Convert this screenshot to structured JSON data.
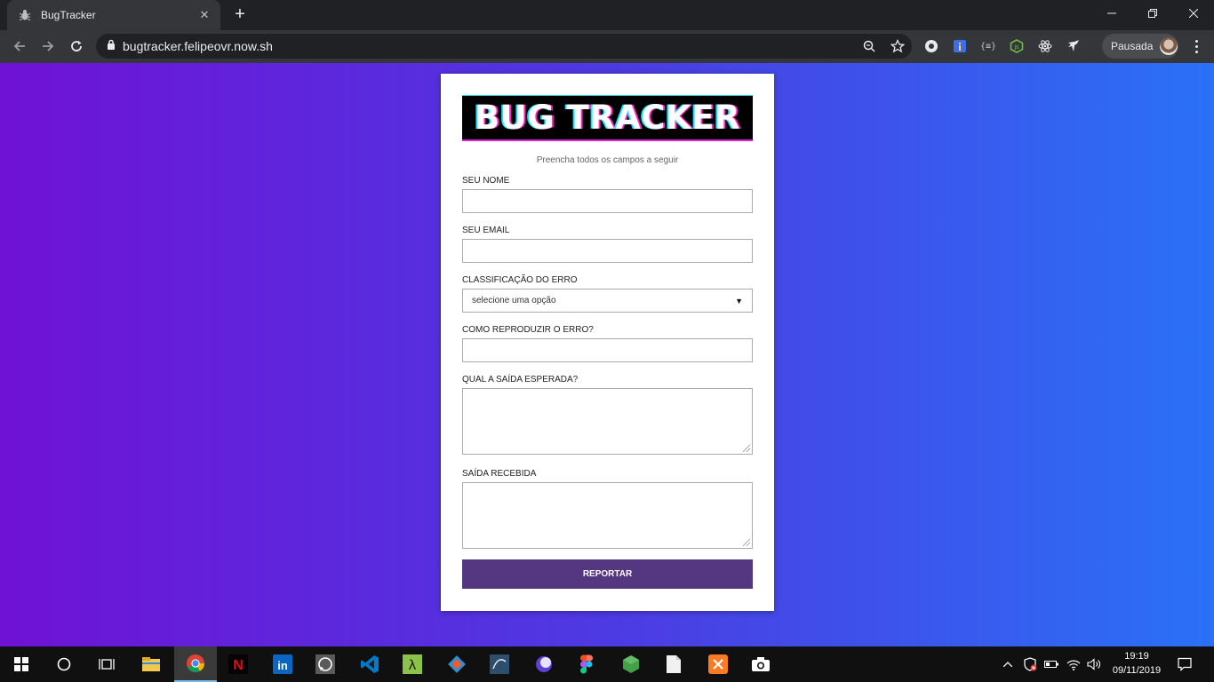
{
  "browser": {
    "tab_title": "BugTracker",
    "url": "bugtracker.felipeovr.now.sh",
    "profile_label": "Pausada"
  },
  "form": {
    "logo_text": "BUG TRACKER",
    "subtitle": "Preencha todos os campos a seguir",
    "name_label": "SEU NOME",
    "email_label": "SEU EMAIL",
    "classification_label": "CLASSIFICAÇÃO DO ERRO",
    "classification_selected": "selecione uma opção",
    "reproduce_label": "COMO REPRODUZIR O ERRO?",
    "expected_label": "QUAL A SAÍDA ESPERADA?",
    "received_label": "SAÍDA RECEBIDA",
    "submit_label": "REPORTAR"
  },
  "taskbar": {
    "time": "19:19",
    "date": "09/11/2019"
  },
  "colors": {
    "bg_gradient_start": "#6f12d6",
    "bg_gradient_end": "#2a71f6",
    "submit_button": "#553781",
    "chrome_dark": "#202124",
    "chrome_toolbar": "#35363a"
  }
}
